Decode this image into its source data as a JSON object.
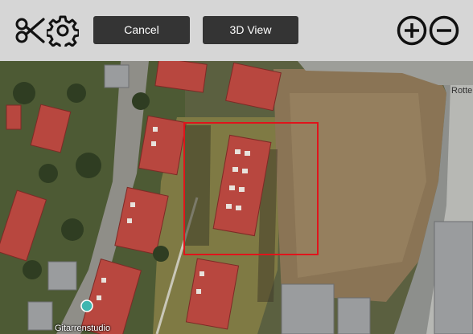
{
  "toolbar": {
    "cancel_label": "Cancel",
    "view3d_label": "3D View",
    "icons": {
      "scissors": "scissors-icon",
      "settings": "gear-icon",
      "zoom_in": "zoom-in-icon",
      "zoom_out": "zoom-out-icon"
    }
  },
  "map": {
    "labels": {
      "place": "Gitarrenstudio",
      "street": "Rotte"
    },
    "selection_color": "#e0141b"
  },
  "colors": {
    "toolbar_bg": "#d6d6d6",
    "button_bg": "#343434",
    "roof": "#b8473f"
  }
}
